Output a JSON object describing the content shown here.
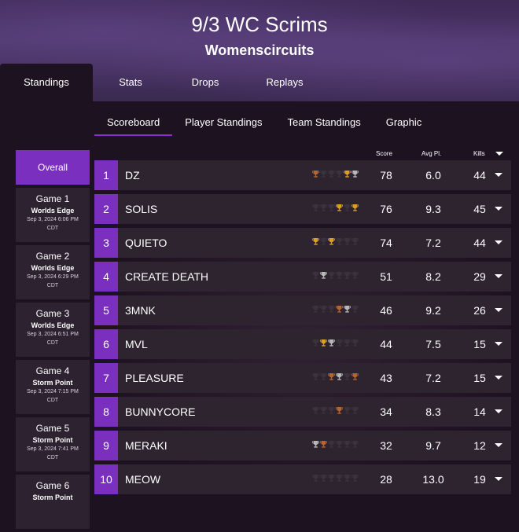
{
  "title": "9/3 WC Scrims",
  "subtitle": "Womenscircuits",
  "main_tabs": [
    "Standings",
    "Stats",
    "Drops",
    "Replays"
  ],
  "sub_tabs": [
    "Scoreboard",
    "Player Standings",
    "Team Standings",
    "Graphic"
  ],
  "sidebar": {
    "overall": "Overall",
    "games": [
      {
        "name": "Game 1",
        "map": "Worlds Edge",
        "date": "Sep 3, 2024 6:06 PM",
        "tz": "CDT"
      },
      {
        "name": "Game 2",
        "map": "Worlds Edge",
        "date": "Sep 3, 2024 6:29 PM",
        "tz": "CDT"
      },
      {
        "name": "Game 3",
        "map": "Worlds Edge",
        "date": "Sep 3, 2024 6:51 PM",
        "tz": "CDT"
      },
      {
        "name": "Game 4",
        "map": "Storm Point",
        "date": "Sep 3, 2024 7:15 PM",
        "tz": "CDT"
      },
      {
        "name": "Game 5",
        "map": "Storm Point",
        "date": "Sep 3, 2024 7:41 PM",
        "tz": "CDT"
      },
      {
        "name": "Game 6",
        "map": "Storm Point",
        "date": "",
        "tz": ""
      }
    ]
  },
  "columns": {
    "score": "Score",
    "avg": "Avg Pl.",
    "kills": "Kills"
  },
  "colors": {
    "accent": "#7b2fbf",
    "gold": "#d9a21b",
    "silver": "#b8b8b8",
    "bronze": "#b8652a",
    "dim": "#3a333c"
  },
  "rows": [
    {
      "rank": "1",
      "team": "DZ",
      "trophies": [
        "bronze",
        "dim",
        "dim",
        "dim",
        "gold",
        "silver"
      ],
      "score": "78",
      "avg": "6.0",
      "kills": "44"
    },
    {
      "rank": "2",
      "team": "SOLIS",
      "trophies": [
        "dim",
        "dim",
        "dim",
        "gold",
        "dim",
        "gold"
      ],
      "score": "76",
      "avg": "9.3",
      "kills": "45"
    },
    {
      "rank": "3",
      "team": "QUIETO",
      "trophies": [
        "gold",
        "dim",
        "gold",
        "dim",
        "dim",
        "dim"
      ],
      "score": "74",
      "avg": "7.2",
      "kills": "44"
    },
    {
      "rank": "4",
      "team": "CREATE DEATH",
      "trophies": [
        "dim",
        "silver",
        "dim",
        "dim",
        "dim",
        "dim"
      ],
      "score": "51",
      "avg": "8.2",
      "kills": "29"
    },
    {
      "rank": "5",
      "team": "3MNK",
      "trophies": [
        "dim",
        "dim",
        "dim",
        "bronze",
        "silver",
        "dim"
      ],
      "score": "46",
      "avg": "9.2",
      "kills": "26"
    },
    {
      "rank": "6",
      "team": "MVL",
      "trophies": [
        "dim",
        "gold",
        "silver",
        "dim",
        "dim",
        "dim"
      ],
      "score": "44",
      "avg": "7.5",
      "kills": "15"
    },
    {
      "rank": "7",
      "team": "PLEASURE",
      "trophies": [
        "dim",
        "dim",
        "bronze",
        "silver",
        "dim",
        "bronze"
      ],
      "score": "43",
      "avg": "7.2",
      "kills": "15"
    },
    {
      "rank": "8",
      "team": "BUNNYCORE",
      "trophies": [
        "dim",
        "dim",
        "dim",
        "bronze",
        "dim",
        "dim"
      ],
      "score": "34",
      "avg": "8.3",
      "kills": "14"
    },
    {
      "rank": "9",
      "team": "MERAKI",
      "trophies": [
        "silver",
        "bronze",
        "dim",
        "dim",
        "dim",
        "dim"
      ],
      "score": "32",
      "avg": "9.7",
      "kills": "12"
    },
    {
      "rank": "10",
      "team": "MEOW",
      "trophies": [
        "dim",
        "dim",
        "dim",
        "dim",
        "dim",
        "dim"
      ],
      "score": "28",
      "avg": "13.0",
      "kills": "19"
    }
  ]
}
